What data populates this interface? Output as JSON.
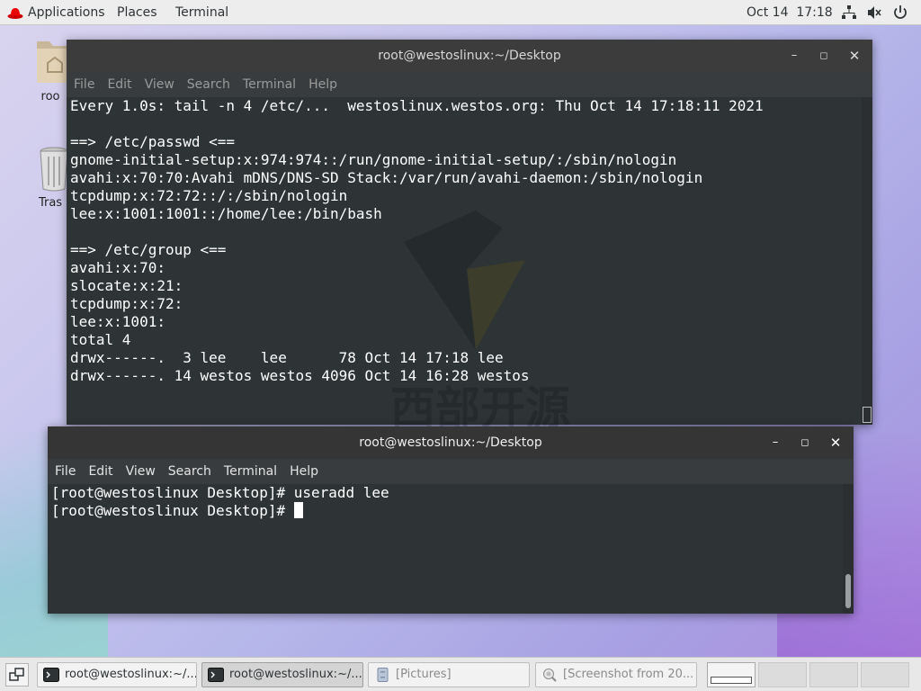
{
  "top_panel": {
    "applications_label": "Applications",
    "places_label": "Places",
    "terminal_label": "Terminal",
    "datetime": "Oct 14  17:18"
  },
  "desktop": {
    "icons": [
      {
        "label": "roo",
        "icon": "home-folder-icon"
      },
      {
        "label": "Tras",
        "icon": "trash-icon"
      }
    ]
  },
  "watch_window": {
    "title": "root@westoslinux:~/Desktop",
    "menu": [
      "File",
      "Edit",
      "View",
      "Search",
      "Terminal",
      "Help"
    ],
    "lines": [
      "Every 1.0s: tail -n 4 /etc/...  westoslinux.westos.org: Thu Oct 14 17:18:11 2021",
      "",
      "==> /etc/passwd <==",
      "gnome-initial-setup:x:974:974::/run/gnome-initial-setup/:/sbin/nologin",
      "avahi:x:70:70:Avahi mDNS/DNS-SD Stack:/var/run/avahi-daemon:/sbin/nologin",
      "tcpdump:x:72:72::/:/sbin/nologin",
      "lee:x:1001:1001::/home/lee:/bin/bash",
      "",
      "==> /etc/group <==",
      "avahi:x:70:",
      "slocate:x:21:",
      "tcpdump:x:72:",
      "lee:x:1001:",
      "total 4",
      "drwx------.  3 lee    lee      78 Oct 14 17:18 lee",
      "drwx------. 14 westos westos 4096 Oct 14 16:28 westos"
    ]
  },
  "shell_window": {
    "title": "root@westoslinux:~/Desktop",
    "menu": [
      "File",
      "Edit",
      "View",
      "Search",
      "Terminal",
      "Help"
    ],
    "lines": [
      "[root@westoslinux Desktop]# useradd lee",
      "[root@westoslinux Desktop]# "
    ]
  },
  "watermark_text": "西部开源",
  "taskbar": {
    "tasks": [
      {
        "label": "root@westoslinux:~/...",
        "icon": "terminal-icon",
        "state": "normal"
      },
      {
        "label": "root@westoslinux:~/...",
        "icon": "terminal-icon",
        "state": "active"
      },
      {
        "label": "[Pictures]",
        "icon": "file-cabinet-icon",
        "state": "minimized"
      },
      {
        "label": "[Screenshot from 20...",
        "icon": "screenshot-icon",
        "state": "minimized"
      }
    ],
    "workspaces": 4,
    "current_workspace": 1
  }
}
